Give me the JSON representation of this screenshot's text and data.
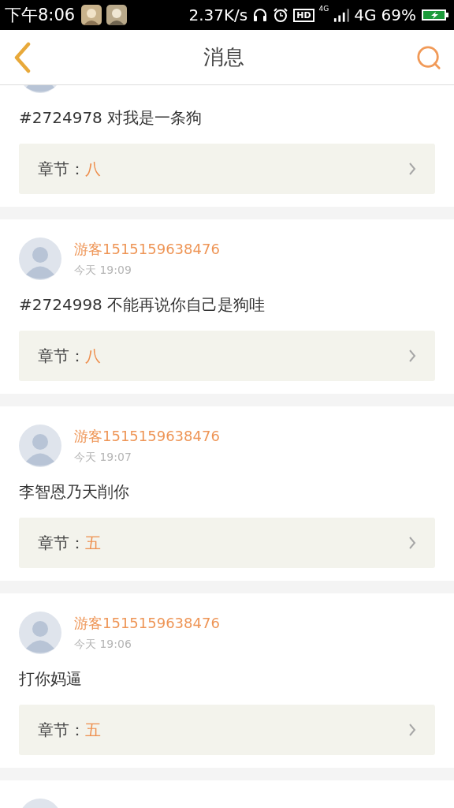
{
  "status_bar": {
    "time": "下午8:06",
    "speed": "2.37K/s",
    "hd": "HD",
    "network_small": "4G",
    "network": "4G",
    "battery": "69%"
  },
  "header": {
    "title": "消息"
  },
  "messages": [
    {
      "kind": "message",
      "comment": "#2724978 对我是一条狗",
      "chapter_label": "章节：",
      "chapter": "八"
    },
    {
      "kind": "message",
      "author": "游客1515159638476",
      "time": "今天 19:09",
      "comment": "#2724998 不能再说你自己是狗哇",
      "chapter_label": "章节：",
      "chapter": "八"
    },
    {
      "kind": "message",
      "author": "游客1515159638476",
      "time": "今天 19:07",
      "comment": "李智恩乃天削你",
      "chapter_label": "章节：",
      "chapter": "五"
    },
    {
      "kind": "message",
      "author": "游客1515159638476",
      "time": "今天 19:06",
      "comment": "打你妈逼",
      "chapter_label": "章节：",
      "chapter": "五"
    },
    {
      "kind": "peek"
    }
  ]
}
